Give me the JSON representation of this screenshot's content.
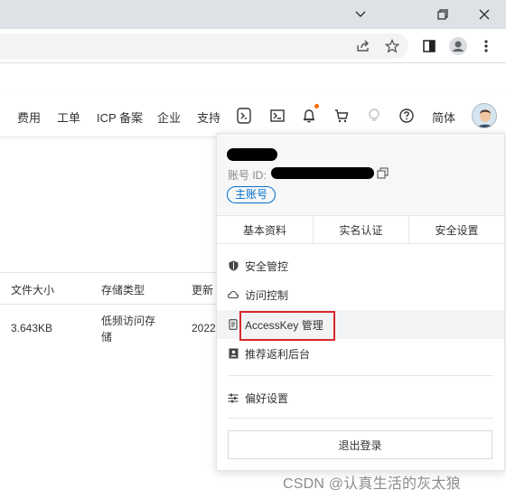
{
  "browser": {
    "window_controls": [
      {
        "name": "minimize",
        "icon": "chevron-down-icon"
      },
      {
        "name": "restore",
        "icon": "restore-icon"
      },
      {
        "name": "close",
        "icon": "close-icon"
      }
    ],
    "toolbar_icons": [
      "share-icon",
      "star-icon",
      "side-panel-icon",
      "profile-icon",
      "more-vert-icon"
    ]
  },
  "topnav": {
    "links": [
      "费用",
      "工单",
      "ICP 备案",
      "企业",
      "支持",
      "简体"
    ],
    "icons": [
      "cloud-shell-icon",
      "terminal-icon",
      "bell-icon",
      "cart-icon",
      "lightbulb-icon",
      "help-icon"
    ],
    "notification_dot_color": "#ff6a00"
  },
  "table": {
    "headers": [
      "文件大小",
      "存储类型",
      "更新"
    ],
    "row": {
      "size": "3.643KB",
      "storage": "低频访问存\n储",
      "updated": "2022"
    }
  },
  "account_menu": {
    "id_label": "账号 ID:",
    "badge": "主账号",
    "tabs": [
      "基本资料",
      "实名认证",
      "安全设置"
    ],
    "items": [
      {
        "label": "安全管控",
        "icon": "shield-icon"
      },
      {
        "label": "访问控制",
        "icon": "cloud-icon"
      },
      {
        "label": "AccessKey 管理",
        "icon": "key-icon"
      },
      {
        "label": "推荐返利后台",
        "icon": "portrait-icon"
      },
      {
        "label": "偏好设置",
        "icon": "sliders-icon"
      }
    ],
    "logout": "退出登录",
    "accent_color": "#0070cc",
    "highlight_box_color": "#d9262c"
  },
  "watermark": "CSDN @认真生活的灰太狼"
}
